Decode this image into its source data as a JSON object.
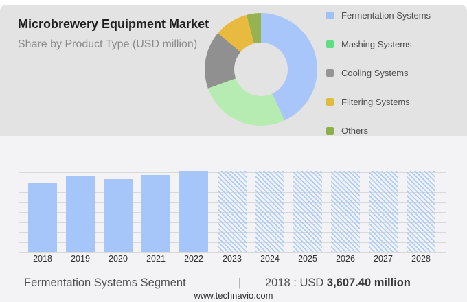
{
  "header": {
    "title": "Microbrewery Equipment Market",
    "subtitle": "Share by Product Type (USD million)"
  },
  "legend": {
    "items": [
      {
        "label": "Fermentation Systems",
        "swatch": "#9fc2f3"
      },
      {
        "label": "Mashing Systems",
        "swatch": "#5edd84"
      },
      {
        "label": "Cooling Systems",
        "swatch": "#959595"
      },
      {
        "label": "Filtering Systems",
        "swatch": "#e0bc3e"
      },
      {
        "label": "Others",
        "swatch": "#8daf4b"
      }
    ]
  },
  "chart_data": [
    {
      "type": "pie",
      "donut": true,
      "title": "Share by Product Type (USD million)",
      "labels": [
        "Fermentation Systems",
        "Mashing Systems",
        "Cooling Systems",
        "Filtering Systems",
        "Others"
      ],
      "values": [
        43.1,
        26.4,
        16.6,
        9.8,
        4.1
      ],
      "value_unit": "percent (estimated from arc angles)",
      "colors": [
        "#a8c6f9",
        "#b6ebb2",
        "#909090",
        "#e9ba40",
        "#95b351"
      ],
      "legend_position": "right",
      "start_angle_deg": 0,
      "direction": "clockwise"
    },
    {
      "type": "bar",
      "title": "Fermentation Systems Segment",
      "categories": [
        "2018",
        "2019",
        "2020",
        "2021",
        "2022",
        "2023",
        "2024",
        "2025",
        "2026",
        "2027",
        "2028"
      ],
      "values_pct_of_max": [
        85.6,
        94.1,
        89.8,
        94.9,
        100,
        100,
        100,
        100,
        100,
        100,
        100
      ],
      "forecast_categories": [
        "2023",
        "2024",
        "2025",
        "2026",
        "2027",
        "2028"
      ],
      "known_point": {
        "category": "2018",
        "label": "USD 3,607.40 million"
      },
      "grid": true,
      "gridline_count": 9,
      "bar_color": "#a6c5f8",
      "hatch_color": "#adccf8",
      "xlabel": "",
      "ylabel": ""
    }
  ],
  "caption": {
    "left": "Fermentation Systems Segment",
    "separator": "|",
    "prefix": "2018 : USD ",
    "value": "3,607.40 million"
  },
  "footer": {
    "url": "www.technavio.com"
  }
}
